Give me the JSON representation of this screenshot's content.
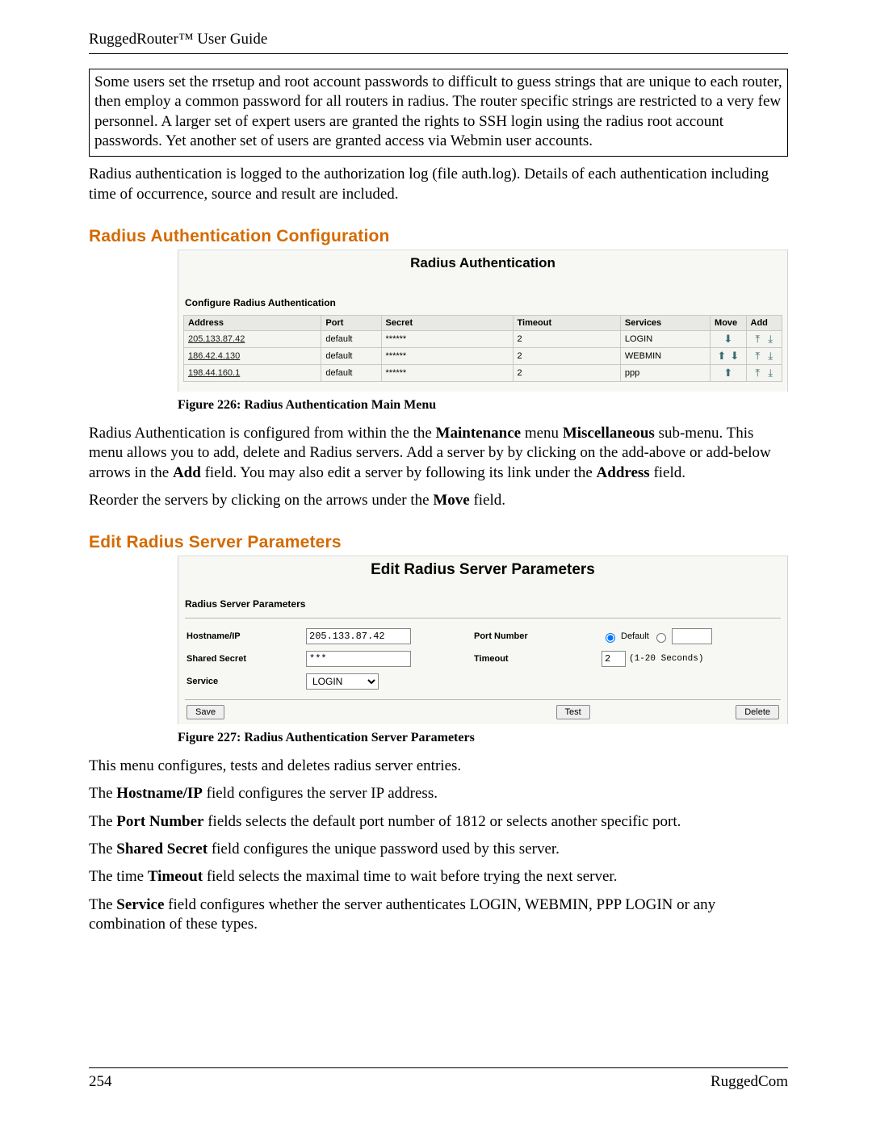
{
  "header": {
    "title": "RuggedRouter™ User Guide"
  },
  "note": "Some users set the rrsetup and root account passwords to difficult to guess strings that are unique to each router, then employ a common password for all routers in radius.  The router specific strings are restricted to a very few personnel.  A larger set of expert users are granted the rights to SSH login using the radius root account passwords.   Yet another set of users are granted access via Webmin user accounts.",
  "para1": "Radius authentication is logged to the authorization log (file auth.log).  Details of each authentication including time of occurrence, source and result are included.",
  "sec1": {
    "heading": "Radius Authentication Configuration",
    "panel_title": "Radius Authentication",
    "panel_sub": "Configure Radius Authentication",
    "cols": {
      "address": "Address",
      "port": "Port",
      "secret": "Secret",
      "timeout": "Timeout",
      "services": "Services",
      "move": "Move",
      "add": "Add"
    },
    "rows": [
      {
        "address": "205.133.87.42",
        "port": "default",
        "secret": "******",
        "timeout": "2",
        "services": "LOGIN",
        "move_up": false,
        "move_down": true
      },
      {
        "address": "186.42.4.130",
        "port": "default",
        "secret": "******",
        "timeout": "2",
        "services": "WEBMIN",
        "move_up": true,
        "move_down": true
      },
      {
        "address": "198.44.160.1",
        "port": "default",
        "secret": "******",
        "timeout": "2",
        "services": "ppp",
        "move_up": true,
        "move_down": false
      }
    ],
    "caption": "Figure 226: Radius Authentication Main Menu"
  },
  "para2_parts": {
    "a": "Radius Authentication is configured from within the the ",
    "b": "Maintenance",
    "c": " menu ",
    "d": "Miscellaneous",
    "e": " sub-menu.  This menu allows you to add, delete and Radius servers. Add a server by by clicking on the add-above or add-below arrows in the ",
    "f": "Add",
    "g": " field. You may also edit a server by following its link under the ",
    "h": "Address",
    "i": " field."
  },
  "para3_parts": {
    "a": "Reorder the servers by clicking on the arrows under the ",
    "b": "Move",
    "c": " field."
  },
  "sec2": {
    "heading": "Edit Radius Server Parameters",
    "panel_title": "Edit Radius Server Parameters",
    "panel_sub": "Radius Server Parameters",
    "labels": {
      "host": "Hostname/IP",
      "port": "Port Number",
      "secret": "Shared Secret",
      "timeout": "Timeout",
      "service": "Service"
    },
    "values": {
      "host": "205.133.87.42",
      "secret": "***",
      "timeout": "2",
      "timeout_hint": "(1-20 Seconds)",
      "port_default_label": "Default",
      "service": "LOGIN"
    },
    "buttons": {
      "save": "Save",
      "test": "Test",
      "delete": "Delete"
    },
    "caption": "Figure 227: Radius Authentication Server Parameters"
  },
  "para4": "This menu configures, tests and deletes radius server entries.",
  "para5_parts": {
    "a": "The ",
    "b": "Hostname/IP",
    "c": " field configures the server IP address."
  },
  "para6_parts": {
    "a": "The ",
    "b": "Port Number",
    "c": " fields selects the default port number of 1812 or selects another specific port."
  },
  "para7_parts": {
    "a": "The ",
    "b": "Shared Secret",
    "c": " field configures the unique password used by this server."
  },
  "para8_parts": {
    "a": "The time ",
    "b": "Timeout",
    "c": " field selects the maximal time to wait before trying the next server."
  },
  "para9_parts": {
    "a": "The ",
    "b": "Service",
    "c": " field configures whether the server authenticates LOGIN, WEBMIN, PPP LOGIN or any combination of these types."
  },
  "footer": {
    "page": "254",
    "brand": "RuggedCom"
  }
}
